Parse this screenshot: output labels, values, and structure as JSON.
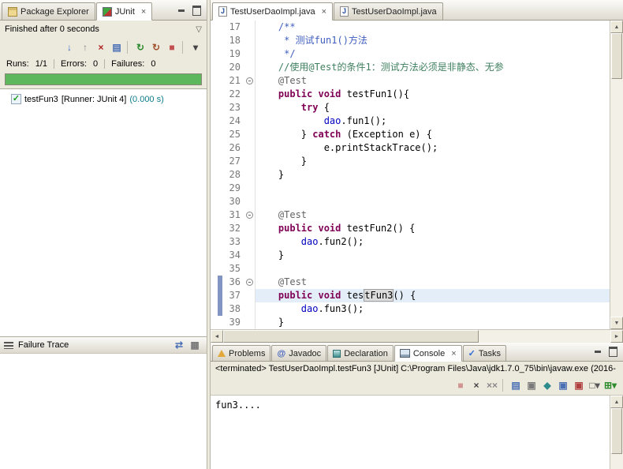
{
  "glyphs": {
    "close": "×",
    "up": "▲",
    "down": "▼",
    "left": "◄",
    "right": "►"
  },
  "left_panel": {
    "tabs": [
      {
        "label": "Package Explorer"
      },
      {
        "label": "JUnit",
        "active": true
      }
    ],
    "status": "Finished after 0 seconds",
    "pulldown_icon": "▽",
    "toolbar_icons": [
      {
        "name": "next-failed-test",
        "glyph": "↓",
        "color": "#3B6CC4"
      },
      {
        "name": "previous-failed-test",
        "glyph": "↑",
        "color": "#8A8A8A"
      },
      {
        "name": "show-failures-only",
        "glyph": "×",
        "color": "#B22222"
      },
      {
        "name": "show-skipped-tests",
        "glyph": "▤",
        "color": "#4A6FB5"
      },
      {
        "name": "separator"
      },
      {
        "name": "rerun-test",
        "glyph": "↻",
        "color": "#2E8B2E"
      },
      {
        "name": "rerun-failed-first",
        "glyph": "↻",
        "color": "#A0522D"
      },
      {
        "name": "stop-junit-run",
        "glyph": "■",
        "color": "#C25050"
      },
      {
        "name": "separator"
      },
      {
        "name": "test-run-history-menu",
        "glyph": "▾",
        "color": "#444444"
      }
    ],
    "counts": {
      "runs_label": "Runs:",
      "runs": "1/1",
      "errors_label": "Errors:",
      "errors": "0",
      "failures_label": "Failures:",
      "failures": "0"
    },
    "progress_color": "#5DB85D",
    "test": {
      "icon": "✓",
      "name": "testFun3",
      "runner": " [Runner: JUnit 4] ",
      "time": "(0.000 s)"
    },
    "failure_trace_title": "Failure Trace",
    "failure_trace_icons": [
      {
        "name": "filter-stack-trace",
        "glyph": "⇄",
        "color": "#4A6FB5"
      },
      {
        "name": "compare-result",
        "glyph": "▦",
        "color": "#777777"
      }
    ]
  },
  "editor": {
    "tabs": [
      {
        "label": "TestUserDaoImpl.java",
        "icon_glyph": "J",
        "active": true
      },
      {
        "label": "TestUserDaoImpl.java",
        "icon_glyph": "J"
      }
    ],
    "lines": [
      {
        "n": 17,
        "tokens": [
          {
            "c": "jd",
            "t": "    /**"
          }
        ]
      },
      {
        "n": 18,
        "tokens": [
          {
            "c": "jd",
            "t": "     * 测试fun1()方法"
          }
        ]
      },
      {
        "n": 19,
        "tokens": [
          {
            "c": "jd",
            "t": "     */"
          }
        ]
      },
      {
        "n": 20,
        "tokens": [
          {
            "c": "cm",
            "t": "    //使用@Test的条件1：测试方法必须是非静态、无参"
          }
        ]
      },
      {
        "n": 21,
        "fold": true,
        "tokens": [
          {
            "c": "an",
            "t": "    @Test"
          }
        ]
      },
      {
        "n": 22,
        "tokens": [
          {
            "c": "kw",
            "t": "    public void "
          },
          {
            "c": "pl",
            "t": "testFun1(){"
          }
        ]
      },
      {
        "n": 23,
        "tokens": [
          {
            "c": "pl",
            "t": "        "
          },
          {
            "c": "kw",
            "t": "try"
          },
          {
            "c": "pl",
            "t": " {"
          }
        ]
      },
      {
        "n": 24,
        "tokens": [
          {
            "c": "pl",
            "t": "            "
          },
          {
            "c": "fd",
            "t": "dao"
          },
          {
            "c": "pl",
            "t": ".fun1();"
          }
        ]
      },
      {
        "n": 25,
        "tokens": [
          {
            "c": "pl",
            "t": "        } "
          },
          {
            "c": "kw",
            "t": "catch"
          },
          {
            "c": "pl",
            "t": " (Exception e) {"
          }
        ]
      },
      {
        "n": 26,
        "tokens": [
          {
            "c": "pl",
            "t": "            e.printStackTrace();"
          }
        ]
      },
      {
        "n": 27,
        "tokens": [
          {
            "c": "pl",
            "t": "        }"
          }
        ]
      },
      {
        "n": 28,
        "tokens": [
          {
            "c": "pl",
            "t": "    }"
          }
        ]
      },
      {
        "n": 29,
        "tokens": []
      },
      {
        "n": 30,
        "tokens": []
      },
      {
        "n": 31,
        "fold": true,
        "tokens": [
          {
            "c": "an",
            "t": "    @Test"
          }
        ]
      },
      {
        "n": 32,
        "tokens": [
          {
            "c": "kw",
            "t": "    public void "
          },
          {
            "c": "pl",
            "t": "testFun2() {"
          }
        ]
      },
      {
        "n": 33,
        "tokens": [
          {
            "c": "pl",
            "t": "        "
          },
          {
            "c": "fd",
            "t": "dao"
          },
          {
            "c": "pl",
            "t": ".fun2();"
          }
        ]
      },
      {
        "n": 34,
        "tokens": [
          {
            "c": "pl",
            "t": "    }"
          }
        ]
      },
      {
        "n": 35,
        "tokens": []
      },
      {
        "n": 36,
        "fold": true,
        "diff": true,
        "tokens": [
          {
            "c": "an",
            "t": "    @Test"
          }
        ]
      },
      {
        "n": 37,
        "diff": true,
        "current": true,
        "tokens": [
          {
            "c": "kw",
            "t": "    public void "
          },
          {
            "c": "pl",
            "t": "tes"
          },
          {
            "c": "cur",
            "t": ""
          },
          {
            "c": "occ",
            "t": "tFun3"
          },
          {
            "c": "pl",
            "t": "() {"
          }
        ]
      },
      {
        "n": 38,
        "diff": true,
        "tokens": [
          {
            "c": "pl",
            "t": "        "
          },
          {
            "c": "fd",
            "t": "dao"
          },
          {
            "c": "pl",
            "t": ".fun3();"
          }
        ]
      },
      {
        "n": 39,
        "tokens": [
          {
            "c": "pl",
            "t": "    }"
          }
        ]
      }
    ]
  },
  "console": {
    "tabs": [
      {
        "label": "Problems"
      },
      {
        "label": "Javadoc",
        "icon_glyph": "@"
      },
      {
        "label": "Declaration"
      },
      {
        "label": "Console",
        "active": true
      },
      {
        "label": "Tasks",
        "icon_glyph": "✓"
      }
    ],
    "status_line": "<terminated> TestUserDaoImpl.testFun3 [JUnit] C:\\Program Files\\Java\\jdk1.7.0_75\\bin\\javaw.exe (2016-",
    "toolbar_icons": [
      {
        "name": "terminate",
        "glyph": "■",
        "color": "#D09492"
      },
      {
        "name": "remove-launch",
        "glyph": "×",
        "color": "#444444"
      },
      {
        "name": "remove-all-launches",
        "glyph": "××",
        "color": "#888888"
      },
      {
        "name": "separator"
      },
      {
        "name": "clear-console",
        "glyph": "▤",
        "color": "#4A6FB5"
      },
      {
        "name": "scroll-lock",
        "glyph": "▣",
        "color": "#7A7A7A"
      },
      {
        "name": "pin-console",
        "glyph": "◆",
        "color": "#2E8B8B"
      },
      {
        "name": "show-console-on-stdout",
        "glyph": "▣",
        "color": "#4A6FB5"
      },
      {
        "name": "show-console-on-stderr",
        "glyph": "▣",
        "color": "#B04040"
      },
      {
        "name": "display-selected-console",
        "glyph": "□▾",
        "color": "#555555"
      },
      {
        "name": "open-console-menu",
        "glyph": "⊞▾",
        "color": "#2E8B2E"
      }
    ],
    "output": "fun3...."
  }
}
